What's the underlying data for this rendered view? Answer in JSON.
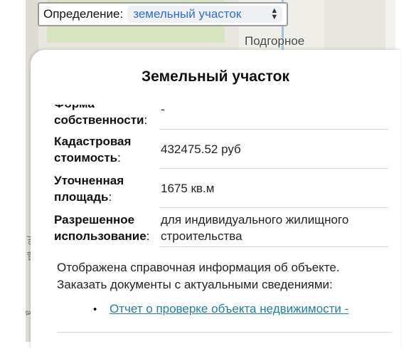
{
  "map": {
    "place_label": "Подгорное",
    "side_labels": [
      "ль",
      "ва",
      "а"
    ]
  },
  "definition": {
    "label": "Определение:",
    "selected": "земельный участок"
  },
  "card": {
    "title": "Земельный участок",
    "rows": [
      {
        "label_top": "Форма",
        "label": "собственности",
        "colon": ":",
        "value": "-"
      },
      {
        "label_top": "Кадастровая",
        "label": "стоимость",
        "colon": ":",
        "value": "432475.52 руб"
      },
      {
        "label_top": "Уточненная",
        "label": "площадь",
        "colon": ":",
        "value": "1675 кв.м"
      },
      {
        "label_top": "Разрешенное",
        "label": "использование",
        "colon": ":",
        "value": "для индивидуального жилищного строительства"
      }
    ],
    "info_line1": "Отображена справочная информация об объекте.",
    "info_line2": "Заказать документы с актуальными сведениями:",
    "bullet": "•",
    "report_link": "Отчет о проверке объекта недвижимости -"
  },
  "colors": {
    "link": "#1f7ea3",
    "select_text": "#2f6fd3"
  }
}
